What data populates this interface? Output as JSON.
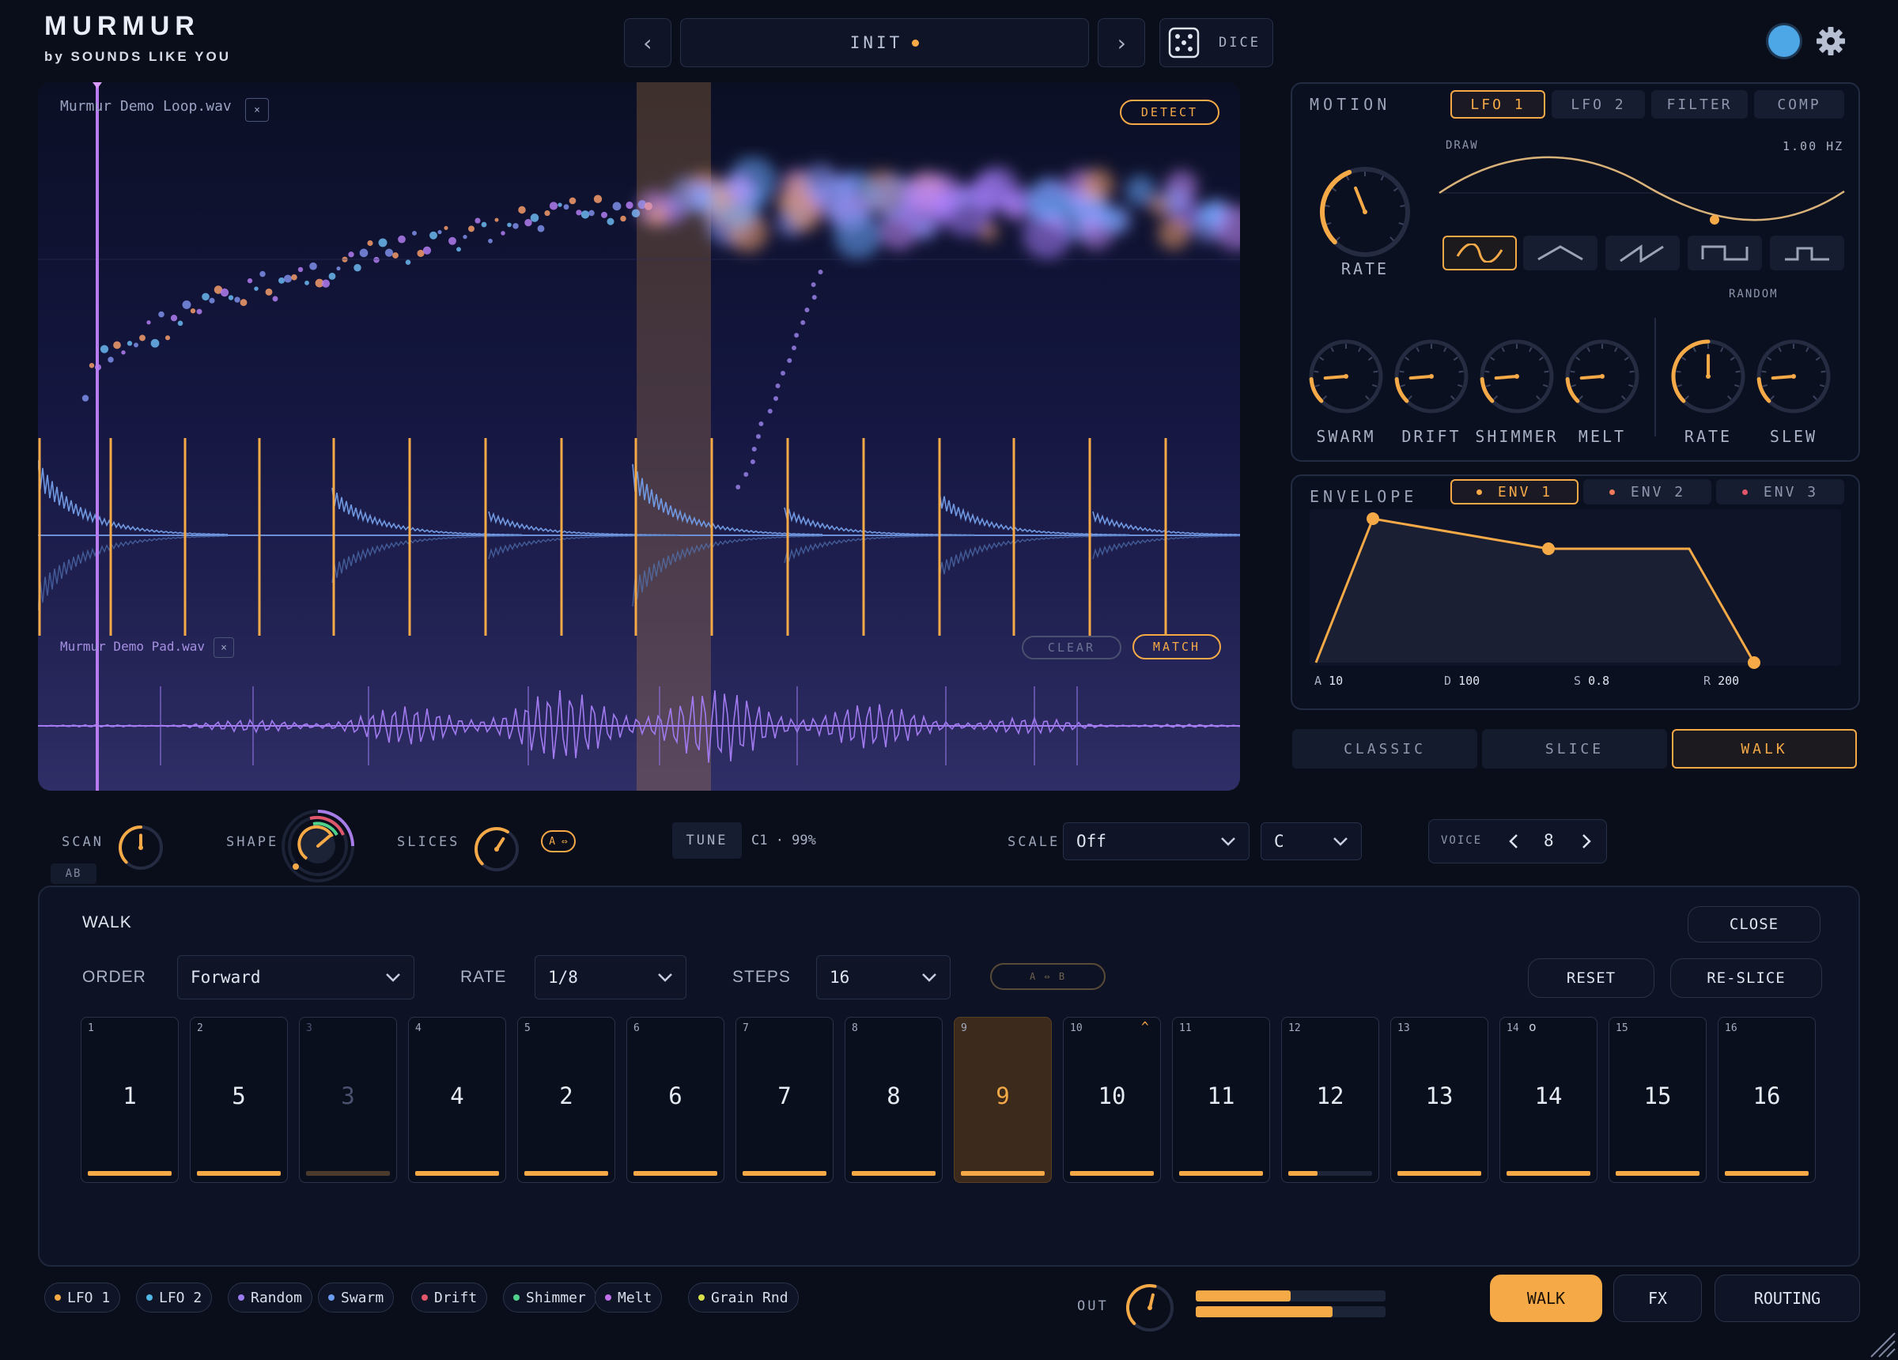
{
  "app": {
    "title": "MURMUR",
    "subtitle": "by SOUNDS LIKE YOU"
  },
  "colors": {
    "accent": "#f5a947",
    "background": "#0a0e1b",
    "purple": "#9b7cf0",
    "blue": "#6c8fd8",
    "status_dot": "#4da6e6"
  },
  "header": {
    "prev_label": "‹",
    "next_label": "›",
    "preset_name": "INIT",
    "dice_label": "DICE",
    "icons": [
      "chevron-left-icon",
      "chevron-right-icon",
      "dice-icon",
      "status-dot-icon",
      "gear-icon"
    ]
  },
  "viz": {
    "sample_a": "Murmur Demo Loop.wav",
    "sample_b": "Murmur Demo Pad.wav",
    "close_glyph": "×",
    "detect_label": "DETECT",
    "clear_label": "CLEAR",
    "match_label": "MATCH"
  },
  "motion": {
    "title": "MOTION",
    "tabs": [
      "LFO 1",
      "LFO 2",
      "FILTER",
      "COMP"
    ],
    "active_tab": "LFO 1",
    "draw_label": "DRAW",
    "rate_value": "1.00 HZ",
    "rate_label": "RATE",
    "random_label": "RANDOM",
    "shapes": [
      "sine-wave-icon",
      "triangle-wave-icon",
      "saw-wave-icon",
      "square-wave-icon",
      "random-step-icon"
    ],
    "active_shape": 0,
    "knobs": [
      {
        "label": "SWARM",
        "level": 0.15
      },
      {
        "label": "DRIFT",
        "level": 0.15
      },
      {
        "label": "SHIMMER",
        "level": 0.15
      },
      {
        "label": "MELT",
        "level": 0.15
      },
      {
        "label": "RATE",
        "level": 0.5
      },
      {
        "label": "SLEW",
        "level": 0.15
      }
    ]
  },
  "envelope": {
    "title": "ENVELOPE",
    "tabs": [
      "ENV 1",
      "ENV 2",
      "ENV 3"
    ],
    "tab_dot_colors": [
      "#f5a947",
      "#f07a5a",
      "#e0566a"
    ],
    "active_tab": "ENV 1",
    "params": [
      {
        "name": "A",
        "value": "10"
      },
      {
        "name": "D",
        "value": "100"
      },
      {
        "name": "S",
        "value": "0.8"
      },
      {
        "name": "R",
        "value": "200"
      }
    ]
  },
  "modes": {
    "items": [
      "CLASSIC",
      "SLICE",
      "WALK"
    ],
    "active": "WALK"
  },
  "controls": {
    "scan_label": "SCAN",
    "shape_label": "SHAPE",
    "slices_label": "SLICES",
    "ab_label": "AB",
    "ab_toggle": "A ⇔",
    "tune_label": "TUNE",
    "tune_value": "C1 · 99%",
    "scale_label": "SCALE",
    "scale_value": "Off",
    "key_value": "C",
    "voice_label": "VOICE",
    "voice_value": "8"
  },
  "walk": {
    "title": "WALK",
    "close_label": "CLOSE",
    "order_label": "ORDER",
    "order_value": "Forward",
    "rate_label": "RATE",
    "rate_value": "1/8",
    "steps_label": "STEPS",
    "steps_value": "16",
    "ab_label": "A ⇔ B",
    "reset_label": "RESET",
    "reslice_label": "RE-SLICE",
    "steps": [
      {
        "index": "1",
        "value": "1",
        "level": 1.0
      },
      {
        "index": "2",
        "value": "5",
        "level": 1.0
      },
      {
        "index": "3",
        "value": "3",
        "level": 1.0,
        "dim": true
      },
      {
        "index": "4",
        "value": "4",
        "level": 1.0
      },
      {
        "index": "5",
        "value": "2",
        "level": 1.0
      },
      {
        "index": "6",
        "value": "6",
        "level": 1.0
      },
      {
        "index": "7",
        "value": "7",
        "level": 1.0
      },
      {
        "index": "8",
        "value": "8",
        "level": 1.0
      },
      {
        "index": "9",
        "value": "9",
        "level": 1.0,
        "active": true
      },
      {
        "index": "10",
        "value": "10",
        "level": 1.0,
        "marker": "^"
      },
      {
        "index": "11",
        "value": "11",
        "level": 1.0
      },
      {
        "index": "12",
        "value": "12",
        "level": 0.35
      },
      {
        "index": "13",
        "value": "13",
        "level": 1.0
      },
      {
        "index": "14",
        "value": "14",
        "level": 1.0,
        "marker": "o"
      },
      {
        "index": "15",
        "value": "15",
        "level": 1.0
      },
      {
        "index": "16",
        "value": "16",
        "level": 1.0
      }
    ]
  },
  "footer": {
    "mod_sources": [
      {
        "label": "LFO 1",
        "color": "#f5a947"
      },
      {
        "label": "LFO 2",
        "color": "#4fb8e6"
      },
      {
        "label": "Random",
        "color": "#9b7cf0"
      },
      {
        "label": "Swarm",
        "color": "#6c9cf0"
      },
      {
        "label": "Drift",
        "color": "#e0566a"
      },
      {
        "label": "Shimmer",
        "color": "#4fd18c"
      },
      {
        "label": "Melt",
        "color": "#c070e8"
      },
      {
        "label": "Grain Rnd",
        "color": "#d6e04a"
      }
    ],
    "out_label": "OUT",
    "out_levels": [
      0.5,
      0.72
    ],
    "walk_label": "WALK",
    "fx_label": "FX",
    "routing_label": "ROUTING"
  }
}
